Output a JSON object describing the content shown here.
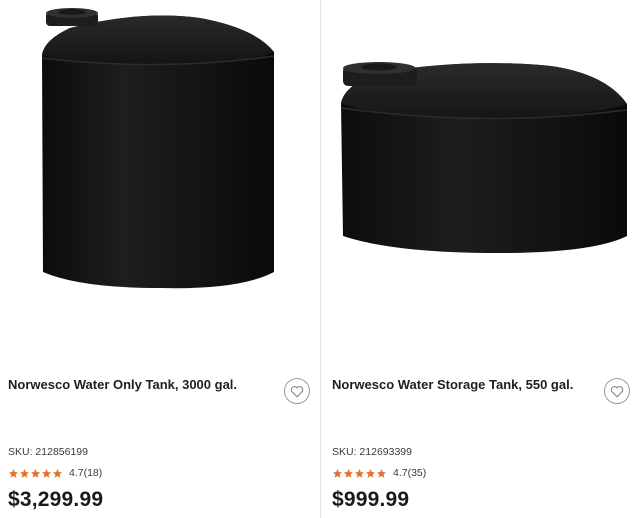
{
  "products": [
    {
      "name": "Norwesco Water Only Tank, 3000 gal.",
      "sku": "SKU: 212856199",
      "rating_text": "4.7(18)",
      "rating": 4.7,
      "price": "$3,299.99",
      "image_icon": "tall-black-water-tank"
    },
    {
      "name": "Norwesco Water Storage Tank, 550 gal.",
      "sku": "SKU: 212693399",
      "rating_text": "4.7(35)",
      "rating": 4.7,
      "price": "$999.99",
      "image_icon": "short-black-water-tank"
    }
  ],
  "colors": {
    "star": "#e8702a",
    "price": "#1a1a1a",
    "tank": "#141414"
  }
}
